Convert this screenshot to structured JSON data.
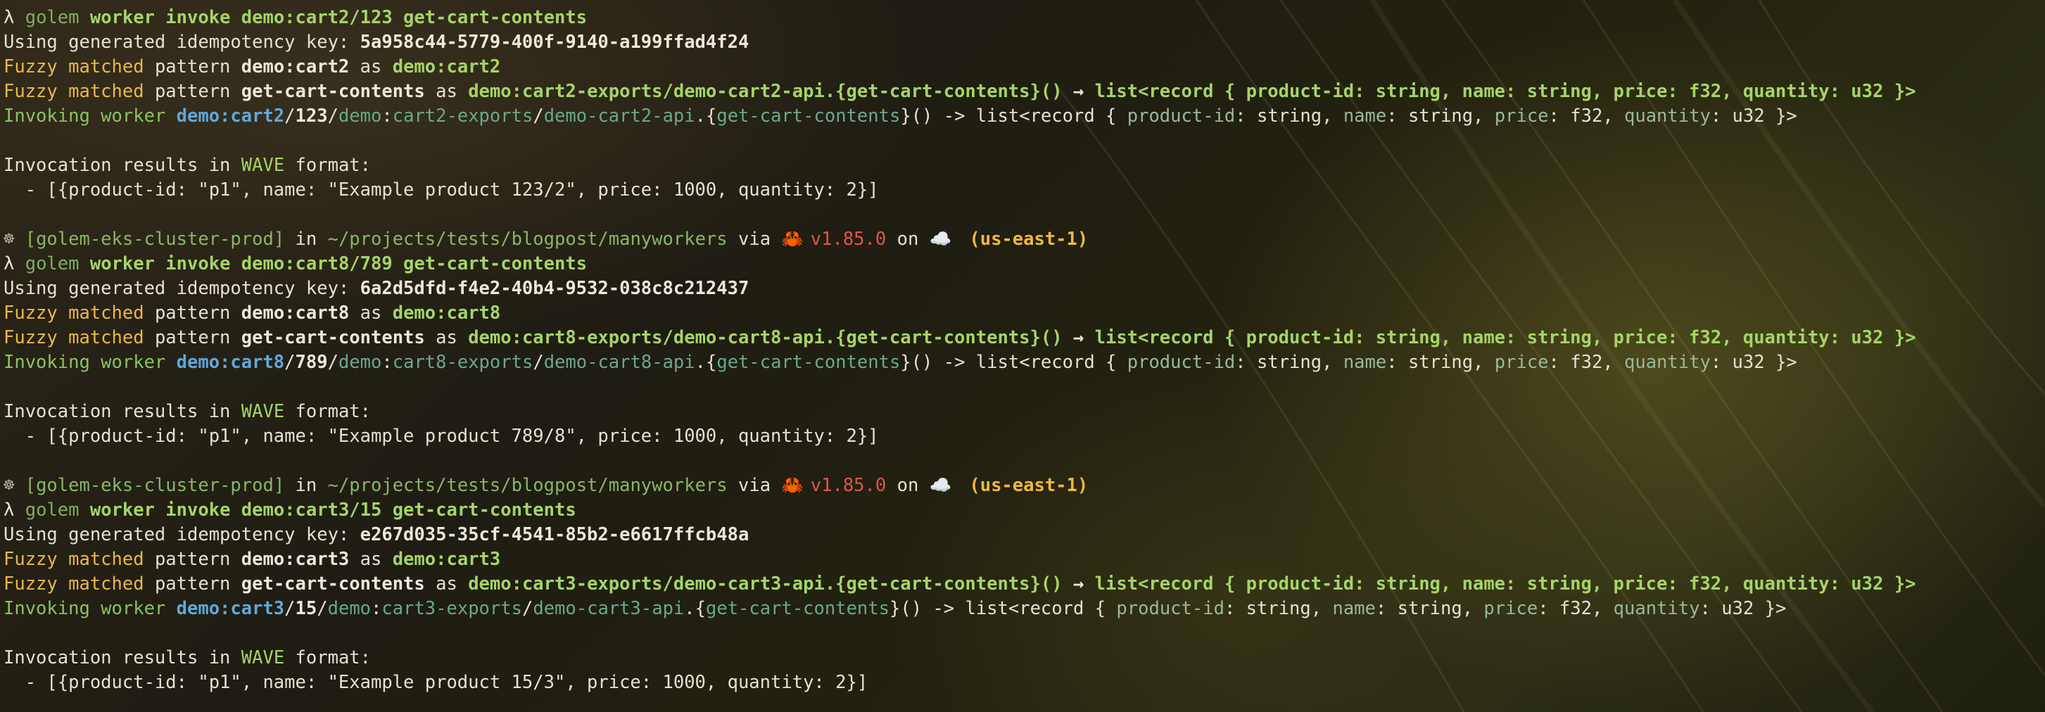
{
  "blocks": [
    {
      "prompt": null,
      "command": {
        "prompt_symbol": "λ",
        "golem": "golem",
        "subcommand": "worker invoke demo:cart2/123 get-cart-contents"
      },
      "idempotency": {
        "label": "Using generated idempotency key: ",
        "key": "5a958c44-5779-400f-9140-a199ffad4f24"
      },
      "fuzzy_component": {
        "prefix": "Fuzzy matched",
        "mid": " pattern ",
        "pattern": "demo:cart2",
        "as": " as ",
        "target": "demo:cart2"
      },
      "fuzzy_function": {
        "prefix": "Fuzzy matched",
        "mid": " pattern ",
        "pattern": "get-cart-contents",
        "as": " as ",
        "target": "demo:cart2-exports/demo-cart2-api.{get-cart-contents}()",
        "arrow": " → ",
        "signature": "list<record { product-id: string, name: string, price: f32, quantity: u32 }>"
      },
      "invoking": {
        "label": "Invoking worker ",
        "component": "demo:cart2",
        "sep1": "/",
        "worker": "123",
        "sep2": "/",
        "pkg": "demo",
        "c1": ":",
        "exports": "cart2-exports",
        "sep3": "/",
        "api": "demo-cart2-api",
        "dot": ".{",
        "fn": "get-cart-contents",
        "tail1": "}() -> list<record { ",
        "f1": "product-id",
        "t1": ": string, ",
        "f2": "name",
        "t2": ": string, ",
        "f3": "price",
        "t3": ": f32, ",
        "f4": "quantity",
        "t4": ": u32 }>"
      },
      "results": {
        "pre": "Invocation results in ",
        "wave": "WAVE",
        "post": " format:",
        "value": "  - [{product-id: \"p1\", name: \"Example product 123/2\", price: 1000, quantity: 2}]"
      }
    },
    {
      "prompt": {
        "icon": "☸",
        "context": " [golem-eks-cluster-prod]",
        "in": " in ",
        "dir": "~/projects/tests/blogpost/manyworkers",
        "via": " via ",
        "rust_icon": "🦀",
        "version": " v1.85.0",
        "on": " on ",
        "cloud_icon": "☁️",
        "region": "  (us-east-1)"
      },
      "command": {
        "prompt_symbol": "λ",
        "golem": "golem",
        "subcommand": "worker invoke demo:cart8/789 get-cart-contents"
      },
      "idempotency": {
        "label": "Using generated idempotency key: ",
        "key": "6a2d5dfd-f4e2-40b4-9532-038c8c212437"
      },
      "fuzzy_component": {
        "prefix": "Fuzzy matched",
        "mid": " pattern ",
        "pattern": "demo:cart8",
        "as": " as ",
        "target": "demo:cart8"
      },
      "fuzzy_function": {
        "prefix": "Fuzzy matched",
        "mid": " pattern ",
        "pattern": "get-cart-contents",
        "as": " as ",
        "target": "demo:cart8-exports/demo-cart8-api.{get-cart-contents}()",
        "arrow": " → ",
        "signature": "list<record { product-id: string, name: string, price: f32, quantity: u32 }>"
      },
      "invoking": {
        "label": "Invoking worker ",
        "component": "demo:cart8",
        "sep1": "/",
        "worker": "789",
        "sep2": "/",
        "pkg": "demo",
        "c1": ":",
        "exports": "cart8-exports",
        "sep3": "/",
        "api": "demo-cart8-api",
        "dot": ".{",
        "fn": "get-cart-contents",
        "tail1": "}() -> list<record { ",
        "f1": "product-id",
        "t1": ": string, ",
        "f2": "name",
        "t2": ": string, ",
        "f3": "price",
        "t3": ": f32, ",
        "f4": "quantity",
        "t4": ": u32 }>"
      },
      "results": {
        "pre": "Invocation results in ",
        "wave": "WAVE",
        "post": " format:",
        "value": "  - [{product-id: \"p1\", name: \"Example product 789/8\", price: 1000, quantity: 2}]"
      }
    },
    {
      "prompt": {
        "icon": "☸",
        "context": " [golem-eks-cluster-prod]",
        "in": " in ",
        "dir": "~/projects/tests/blogpost/manyworkers",
        "via": " via ",
        "rust_icon": "🦀",
        "version": " v1.85.0",
        "on": " on ",
        "cloud_icon": "☁️",
        "region": "  (us-east-1)"
      },
      "command": {
        "prompt_symbol": "λ",
        "golem": "golem",
        "subcommand": "worker invoke demo:cart3/15 get-cart-contents"
      },
      "idempotency": {
        "label": "Using generated idempotency key: ",
        "key": "e267d035-35cf-4541-85b2-e6617ffcb48a"
      },
      "fuzzy_component": {
        "prefix": "Fuzzy matched",
        "mid": " pattern ",
        "pattern": "demo:cart3",
        "as": " as ",
        "target": "demo:cart3"
      },
      "fuzzy_function": {
        "prefix": "Fuzzy matched",
        "mid": " pattern ",
        "pattern": "get-cart-contents",
        "as": " as ",
        "target": "demo:cart3-exports/demo-cart3-api.{get-cart-contents}()",
        "arrow": " → ",
        "signature": "list<record { product-id: string, name: string, price: f32, quantity: u32 }>"
      },
      "invoking": {
        "label": "Invoking worker ",
        "component": "demo:cart3",
        "sep1": "/",
        "worker": "15",
        "sep2": "/",
        "pkg": "demo",
        "c1": ":",
        "exports": "cart3-exports",
        "sep3": "/",
        "api": "demo-cart3-api",
        "dot": ".{",
        "fn": "get-cart-contents",
        "tail1": "}() -> list<record { ",
        "f1": "product-id",
        "t1": ": string, ",
        "f2": "name",
        "t2": ": string, ",
        "f3": "price",
        "t3": ": f32, ",
        "f4": "quantity",
        "t4": ": u32 }>"
      },
      "results": {
        "pre": "Invocation results in ",
        "wave": "WAVE",
        "post": " format:",
        "value": "  - [{product-id: \"p1\", name: \"Example product 15/3\", price: 1000, quantity: 2}]"
      }
    }
  ]
}
